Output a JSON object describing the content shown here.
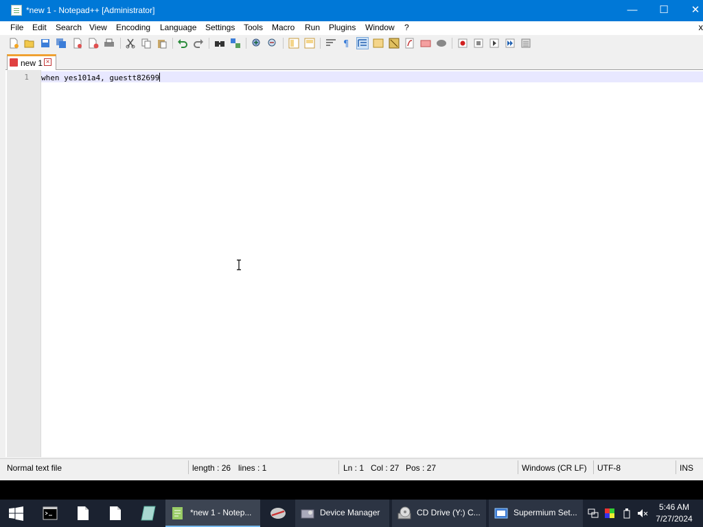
{
  "window": {
    "title": "*new 1 - Notepad++ [Administrator]",
    "controls": {
      "minimize": "—",
      "maximize": "☐",
      "close": "✕"
    }
  },
  "menu": {
    "items": [
      "File",
      "Edit",
      "Search",
      "View",
      "Encoding",
      "Language",
      "Settings",
      "Tools",
      "Macro",
      "Run",
      "Plugins",
      "Window",
      "?"
    ],
    "close_doc": "x"
  },
  "toolbar": {
    "icons": [
      "new-icon",
      "open-icon",
      "save-icon",
      "save-all-icon",
      "close-icon",
      "close-all-icon",
      "print-icon",
      "cut-icon",
      "copy-icon",
      "paste-icon",
      "undo-icon",
      "redo-icon",
      "find-icon",
      "replace-icon",
      "zoom-in-icon",
      "zoom-out-icon",
      "sync-vertical-icon",
      "sync-horizontal-icon",
      "word-wrap-icon",
      "show-all-chars-icon",
      "indent-guide-icon",
      "udl-icon",
      "doc-map-icon",
      "function-list-icon",
      "folder-workspace-icon",
      "monitoring-icon",
      "record-macro-icon",
      "stop-record-icon",
      "play-macro-icon",
      "run-macro-multiple-icon",
      "save-macro-icon"
    ]
  },
  "tab": {
    "label": "new 1"
  },
  "editor": {
    "line_number": "1",
    "text": "when yes101a4, guestt82699"
  },
  "status": {
    "file_type": "Normal text file",
    "length": "length : 26",
    "lines": "lines : 1",
    "ln": "Ln : 1",
    "col": "Col : 27",
    "pos": "Pos : 27",
    "eol": "Windows (CR LF)",
    "encoding": "UTF-8",
    "mode": "INS"
  },
  "taskbar": {
    "items": [
      {
        "label": "*new 1 - Notep...",
        "icon": "notepadpp-icon"
      },
      {
        "label": "Device Manager",
        "icon": "device-manager-icon"
      },
      {
        "label": "CD Drive (Y:) C...",
        "icon": "cd-drive-icon"
      },
      {
        "label": "Supermium Set...",
        "icon": "installer-icon"
      }
    ],
    "clock_time": "5:46 AM",
    "clock_date": "7/27/2024"
  },
  "colors": {
    "titlebar": "#0078d7",
    "taskbar": "#1b2230",
    "current_line": "#e8e8ff",
    "tab_accent": "#f0a030"
  }
}
